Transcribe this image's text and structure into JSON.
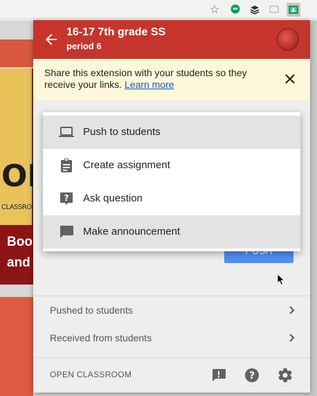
{
  "browser": {
    "star_icon": "star-icon",
    "extensions": [
      "hangouts-icon",
      "buffer-icon",
      "cast-icon",
      "google-classroom-icon"
    ]
  },
  "background": {
    "board_text": "CLASSROOM",
    "board_big": "OK",
    "banner_line1": "Boo",
    "banner_line2": "and"
  },
  "header": {
    "title": "16-17 7th grade SS",
    "subtitle": "period 6",
    "color": "#c5352b"
  },
  "notice": {
    "text": "Share this extension with your students so they receive your links. ",
    "link": "Learn more",
    "background": "#fcf8d9"
  },
  "main": {
    "button_label": "PUSH"
  },
  "menu": {
    "items": [
      {
        "label": "Push to students",
        "icon": "laptop-icon"
      },
      {
        "label": "Create assignment",
        "icon": "clipboard-icon"
      },
      {
        "label": "Ask question",
        "icon": "question-icon"
      },
      {
        "label": "Make announcement",
        "icon": "announcement-icon"
      }
    ]
  },
  "sections": [
    {
      "label": "Pushed to students"
    },
    {
      "label": "Received from students"
    }
  ],
  "footer": {
    "open_label": "OPEN CLASSROOM",
    "icons": [
      "feedback-icon",
      "help-icon",
      "settings-icon"
    ]
  }
}
